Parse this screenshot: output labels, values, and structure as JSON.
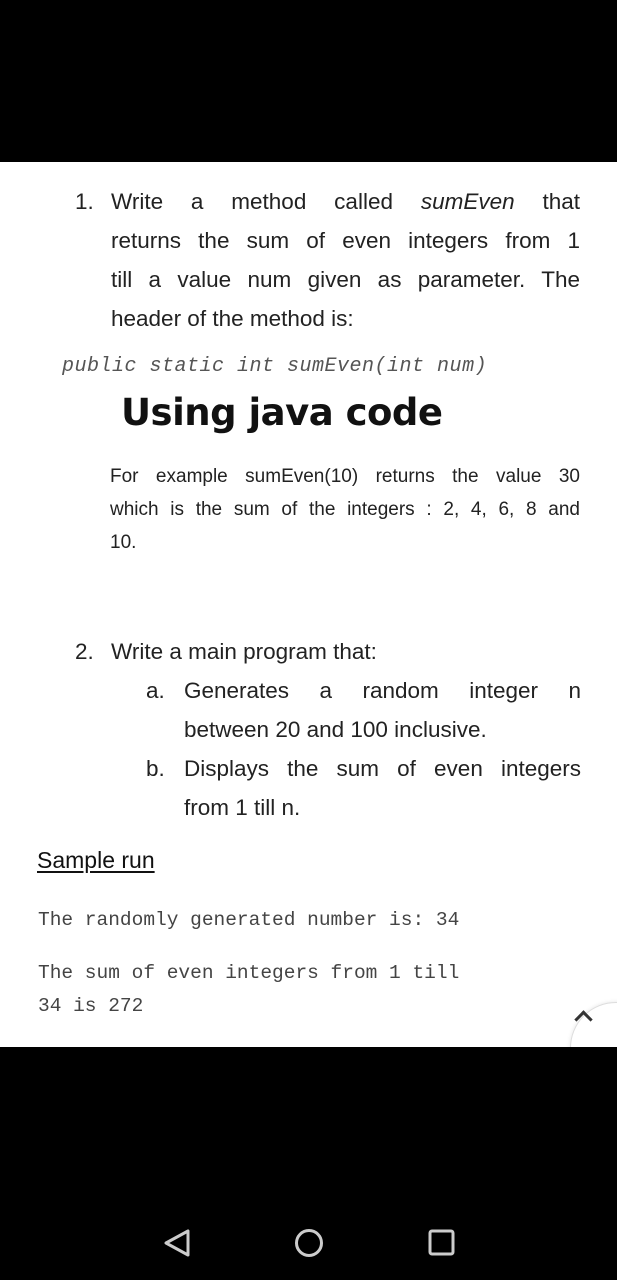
{
  "document": {
    "q1": {
      "number": "1.",
      "lines": [
        [
          "Write a method called ",
          "sumEven",
          " that"
        ],
        "returns the sum of even integers from 1",
        "till a value num given as parameter. The",
        "header of the method is:"
      ]
    },
    "signature": "public static int sumEven(int num)",
    "heading": "Using java code",
    "example": {
      "lines": [
        "For example sumEven(10) returns the value 30",
        "which is the sum of the integers : 2, 4, 6, 8 and",
        "10."
      ]
    },
    "q2": {
      "number": "2.",
      "title": "Write a main program that:",
      "items": [
        {
          "label": "a.",
          "lines": [
            "Generates a random integer n",
            "between 20 and 100 inclusive."
          ]
        },
        {
          "label": "b.",
          "lines": [
            "Displays the sum of even integers",
            "from 1 till n."
          ]
        }
      ]
    },
    "sample_run": {
      "title": "Sample run",
      "output_line_1": "The randomly generated number is: 34",
      "output_line_2": "The sum of even integers from 1 till\n34 is 272"
    }
  },
  "controls": {
    "scroll_up_icon": "chevron-up-icon"
  },
  "navigation_bar": {
    "back_icon": "back-triangle-icon",
    "home_icon": "home-circle-icon",
    "recents_icon": "recents-square-icon"
  }
}
